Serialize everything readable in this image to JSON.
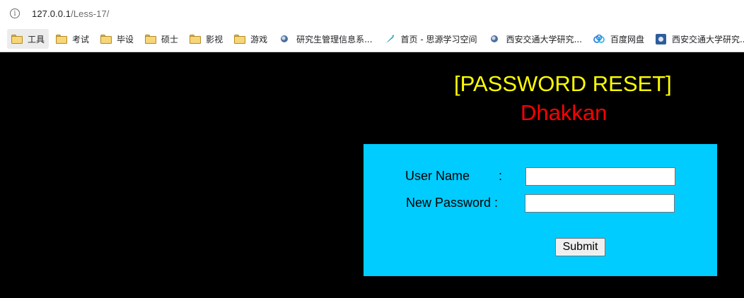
{
  "browser": {
    "url_host": "127.0.0.1",
    "url_path": "/Less-17/",
    "bookmarks": [
      {
        "label": "工具",
        "icon": "folder-icon"
      },
      {
        "label": "考试",
        "icon": "folder-icon"
      },
      {
        "label": "毕设",
        "icon": "folder-icon"
      },
      {
        "label": "硕士",
        "icon": "folder-icon"
      },
      {
        "label": "影视",
        "icon": "folder-icon"
      },
      {
        "label": "游戏",
        "icon": "folder-icon"
      },
      {
        "label": "研究生管理信息系...",
        "icon": "university-seal-icon"
      },
      {
        "label": "首页 - 思源学习空间",
        "icon": "feather-icon"
      },
      {
        "label": "西安交通大学研究...",
        "icon": "university-seal-icon"
      },
      {
        "label": "百度网盘",
        "icon": "cloud-icon"
      },
      {
        "label": "西安交通大学研究...",
        "icon": "blue-badge-icon"
      }
    ]
  },
  "page": {
    "title": "[PASSWORD RESET]",
    "subtitle": "Dhakkan",
    "form": {
      "username_label": "User Name",
      "username_colon": ":",
      "username_value": "",
      "password_label": "New Password :",
      "password_value": "",
      "submit_label": "Submit"
    }
  },
  "colors": {
    "page_background": "#000000",
    "title": "#ffff00",
    "subtitle": "#ff0000",
    "form_background": "#00ccff"
  }
}
